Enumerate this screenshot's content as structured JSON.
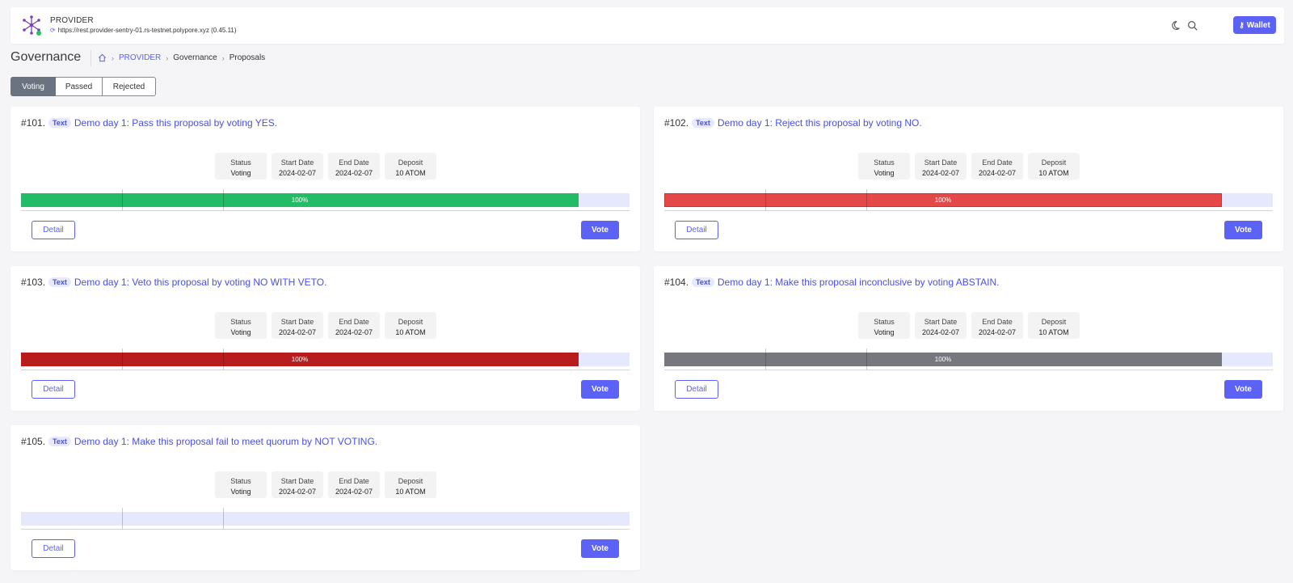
{
  "header": {
    "chain_name": "PROVIDER",
    "endpoint": "https://rest.provider-sentry-01.rs-testnet.polypore.xyz (0.45.11)",
    "wallet_label": "Wallet",
    "theme_icon": "moon-icon",
    "search_icon": "search-icon"
  },
  "page": {
    "title": "Governance",
    "breadcrumb": [
      "PROVIDER",
      "Governance",
      "Proposals"
    ]
  },
  "tabs": [
    {
      "label": "Voting",
      "active": true
    },
    {
      "label": "Passed",
      "active": false
    },
    {
      "label": "Rejected",
      "active": false
    }
  ],
  "stat_labels": {
    "status": "Status",
    "start": "Start Date",
    "end": "End Date",
    "deposit": "Deposit"
  },
  "buttons": {
    "detail": "Detail",
    "vote": "Vote"
  },
  "proposals": [
    {
      "id": "#101.",
      "type": "Text",
      "title": "Demo day 1: Pass this proposal by voting YES.",
      "status": "Voting",
      "start": "2024-02-07",
      "end": "2024-02-07",
      "deposit": "10 ATOM",
      "tally_percent": "100%",
      "tally_fraction": 1.0,
      "color": "#22bb66"
    },
    {
      "id": "#102.",
      "type": "Text",
      "title": "Demo day 1: Reject this proposal by voting NO.",
      "status": "Voting",
      "start": "2024-02-07",
      "end": "2024-02-07",
      "deposit": "10 ATOM",
      "tally_percent": "100%",
      "tally_fraction": 1.0,
      "color": "#e54848"
    },
    {
      "id": "#103.",
      "type": "Text",
      "title": "Demo day 1: Veto this proposal by voting NO WITH VETO.",
      "status": "Voting",
      "start": "2024-02-07",
      "end": "2024-02-07",
      "deposit": "10 ATOM",
      "tally_percent": "100%",
      "tally_fraction": 1.0,
      "color": "#b91c1c"
    },
    {
      "id": "#104.",
      "type": "Text",
      "title": "Demo day 1: Make this proposal inconclusive by voting ABSTAIN.",
      "status": "Voting",
      "start": "2024-02-07",
      "end": "2024-02-07",
      "deposit": "10 ATOM",
      "tally_percent": "100%",
      "tally_fraction": 1.0,
      "color": "#76787d"
    },
    {
      "id": "#105.",
      "type": "Text",
      "title": "Demo day 1: Make this proposal fail to meet quorum by NOT VOTING.",
      "status": "Voting",
      "start": "2024-02-07",
      "end": "2024-02-07",
      "deposit": "10 ATOM",
      "tally_percent": "",
      "tally_fraction": 0,
      "color": "#e6e9fb"
    }
  ]
}
